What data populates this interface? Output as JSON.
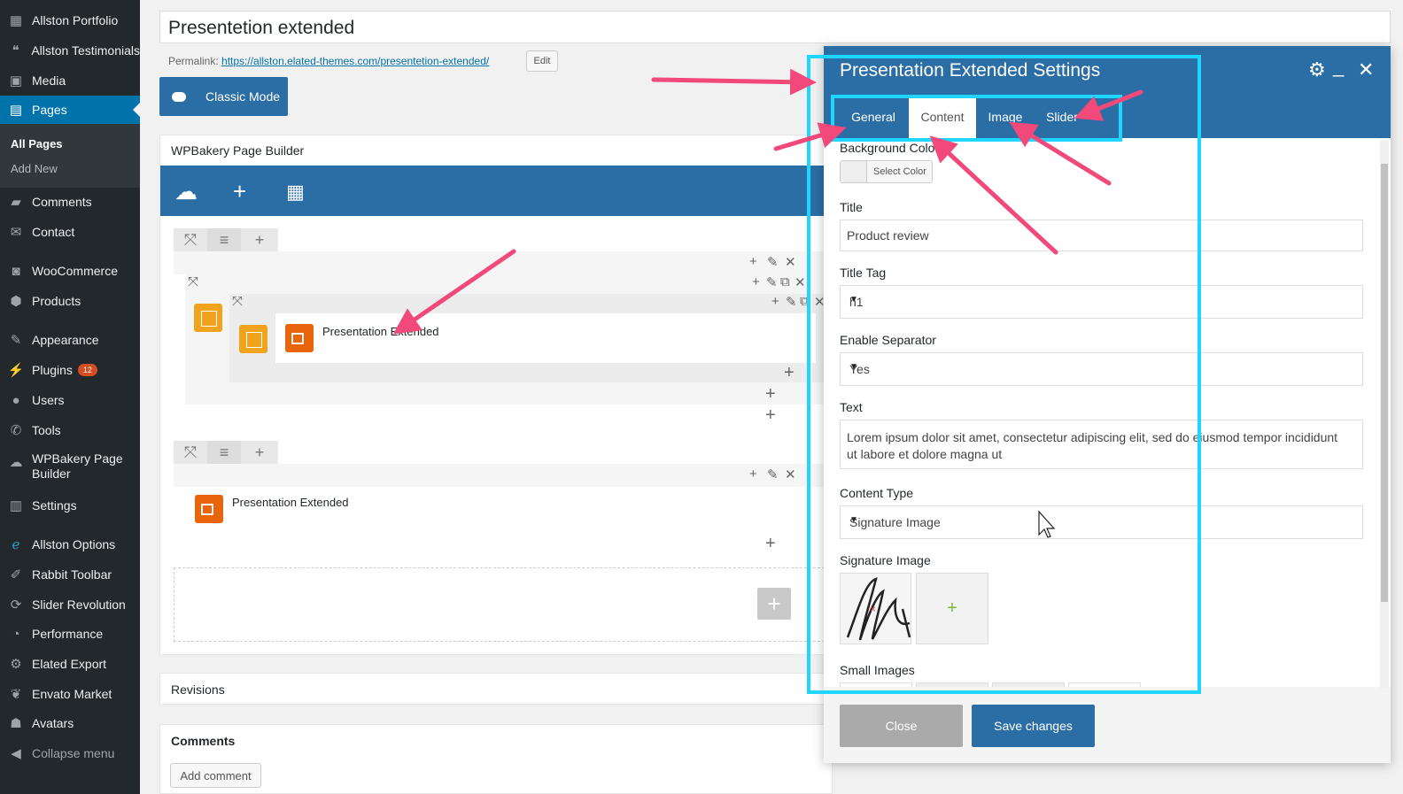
{
  "sidebar": {
    "items": [
      {
        "label": "Allston Portfolio",
        "icon": "grid-icon"
      },
      {
        "label": "Allston Testimonials",
        "icon": "quote-icon"
      },
      {
        "label": "Media",
        "icon": "media-icon"
      },
      {
        "label": "Pages",
        "icon": "pages-icon",
        "active": true
      },
      {
        "label": "Comments",
        "icon": "comment-icon"
      },
      {
        "label": "Contact",
        "icon": "mail-icon"
      },
      {
        "label": "WooCommerce",
        "icon": "woo-icon"
      },
      {
        "label": "Products",
        "icon": "box-icon"
      },
      {
        "label": "Appearance",
        "icon": "brush-icon"
      },
      {
        "label": "Plugins",
        "icon": "plug-icon",
        "badge": "12"
      },
      {
        "label": "Users",
        "icon": "user-icon"
      },
      {
        "label": "Tools",
        "icon": "wrench-icon"
      },
      {
        "label": "WPBakery Page",
        "label2": "Builder",
        "icon": "cloud-icon"
      },
      {
        "label": "Settings",
        "icon": "sliders-icon"
      },
      {
        "label": "Allston Options",
        "icon": "e-icon"
      },
      {
        "label": "Rabbit Toolbar",
        "icon": "rabbit-icon"
      },
      {
        "label": "Slider Revolution",
        "icon": "refresh-icon"
      },
      {
        "label": "Performance",
        "icon": "gauge-icon"
      },
      {
        "label": "Elated Export",
        "icon": "gear-icon"
      },
      {
        "label": "Envato Market",
        "icon": "leaf-icon"
      },
      {
        "label": "Avatars",
        "icon": "avatar-icon"
      },
      {
        "label": "Collapse menu",
        "icon": "collapse-icon"
      }
    ],
    "sub": {
      "all_pages": "All Pages",
      "add_new": "Add New"
    }
  },
  "editor": {
    "title": "Presentetion extended",
    "permalink_label": "Permalink:",
    "permalink_url": "https://allston.elated-themes.com/presentetion-extended/",
    "edit_label": "Edit",
    "classic_mode": "Classic Mode"
  },
  "builder": {
    "title": "WPBakery Page Builder",
    "element_1": "Presentation Extended",
    "element_2": "Presentation Extended"
  },
  "panels": {
    "revisions": "Revisions",
    "comments": "Comments",
    "add_comment": "Add comment"
  },
  "modal": {
    "title": "Presentation Extended Settings",
    "tabs": [
      {
        "label": "General",
        "active": false
      },
      {
        "label": "Content",
        "active": true
      },
      {
        "label": "Image",
        "active": false
      },
      {
        "label": "Slider",
        "active": false
      }
    ],
    "fields": {
      "background_color_label": "Background Colo",
      "select_color": "Select Color",
      "title_label": "Title",
      "title_value": "Product review",
      "title_tag_label": "Title Tag",
      "title_tag_value": "h1",
      "separator_label": "Enable Separator",
      "separator_value": "Yes",
      "text_label": "Text",
      "text_value": "Lorem ipsum dolor sit amet, consectetur adipiscing elit, sed do eiusmod tempor incididunt ut labore et dolore magna ut",
      "content_type_label": "Content Type",
      "content_type_value": "Signature Image",
      "signature_label": "Signature Image",
      "small_images_label": "Small Images",
      "add_symbol": "+"
    },
    "close_label": "Close",
    "save_label": "Save changes"
  },
  "colors": {
    "sidebar_bg": "#23282d",
    "accent": "#2b6ea6",
    "highlight": "#1ed6ff",
    "arrow": "#f0497a",
    "element_orange": "#e8650b"
  }
}
